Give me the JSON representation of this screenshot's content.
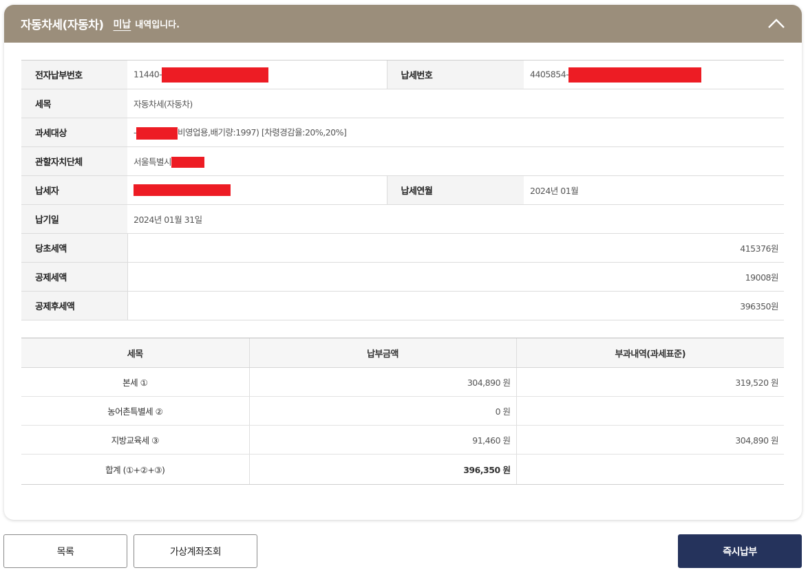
{
  "header": {
    "title": "자동차세(자동차)",
    "status": "미납",
    "suffix": "내역입니다."
  },
  "info": {
    "electronic_payment_no_label": "전자납부번호",
    "electronic_payment_no": "11440-",
    "tax_payment_no_label": "납세번호",
    "tax_payment_no": "4405854-",
    "tax_item_label": "세목",
    "tax_item": "자동차세(자동차)",
    "tax_object_label": "과세대상",
    "tax_object_prefix": "-",
    "tax_object": "비영업용,배기량:1997) [차령경감율:20%,20%]",
    "jurisdiction_label": "관할자치단체",
    "jurisdiction": "서울특별시",
    "taxpayer_label": "납세자",
    "tax_month_label": "납세연월",
    "tax_month": "2024년 01월",
    "due_date_label": "납기일",
    "due_date": "2024년 01월 31일",
    "original_tax_label": "당초세액",
    "original_tax": "415376원",
    "deduction_label": "공제세액",
    "deduction": "19008원",
    "after_deduction_label": "공제후세액",
    "after_deduction": "396350원"
  },
  "detail": {
    "headers": [
      "세목",
      "납부금액",
      "부과내역(과세표준)"
    ],
    "rows": [
      {
        "item": "본세 ①",
        "amount": "304,890 원",
        "basis": "319,520 원"
      },
      {
        "item": "농어촌특별세 ②",
        "amount": "0 원",
        "basis": ""
      },
      {
        "item": "지방교육세 ③",
        "amount": "91,460 원",
        "basis": "304,890 원"
      }
    ],
    "total": {
      "item": "합계 (①+②+③)",
      "amount": "396,350 원",
      "basis": ""
    }
  },
  "buttons": {
    "list": "목록",
    "virtual_account": "가상계좌조회",
    "pay_now": "즉시납부"
  },
  "colors": {
    "header_bg": "#9b8e7b",
    "primary_button": "#25335c",
    "redaction": "#ed1c24"
  }
}
